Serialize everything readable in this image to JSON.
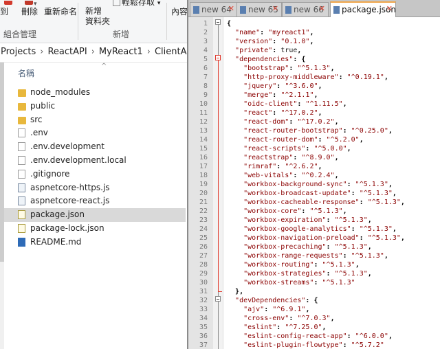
{
  "ribbon": {
    "buttons": [
      "到",
      "刪除",
      "重新命名",
      "新增\n資料夾",
      "輕鬆存取",
      "內容"
    ],
    "groups": [
      "組合管理",
      "新增"
    ]
  },
  "address": {
    "crumbs": [
      "Projects",
      "ReactAPI",
      "MyReact1",
      "ClientApp"
    ]
  },
  "list": {
    "column_name": "名稱",
    "items": [
      {
        "name": "node_modules",
        "icon": "folder-icon"
      },
      {
        "name": "public",
        "icon": "folder-icon"
      },
      {
        "name": "src",
        "icon": "folder-icon"
      },
      {
        "name": ".env",
        "icon": "file-icon"
      },
      {
        "name": ".env.development",
        "icon": "file-icon"
      },
      {
        "name": ".env.development.local",
        "icon": "file-icon"
      },
      {
        "name": ".gitignore",
        "icon": "file-icon"
      },
      {
        "name": "aspnetcore-https.js",
        "icon": "js-file-icon"
      },
      {
        "name": "aspnetcore-react.js",
        "icon": "js-file-icon"
      },
      {
        "name": "package.json",
        "icon": "json-file-icon",
        "selected": true
      },
      {
        "name": "package-lock.json",
        "icon": "json-file-icon"
      },
      {
        "name": "README.md",
        "icon": "markdown-file-icon"
      }
    ]
  },
  "editor": {
    "tabs": [
      {
        "label": "new 64",
        "active": false
      },
      {
        "label": "new 65",
        "active": false
      },
      {
        "label": "new 66",
        "active": false
      },
      {
        "label": "package.json",
        "active": true
      }
    ],
    "lines": [
      "{",
      "  \"name\": \"myreact1\",",
      "  \"version\": \"0.1.0\",",
      "  \"private\": true,",
      "  \"dependencies\": {",
      "    \"bootstrap\": \"^5.1.3\",",
      "    \"http-proxy-middleware\": \"^0.19.1\",",
      "    \"jquery\": \"^3.6.0\",",
      "    \"merge\": \"^2.1.1\",",
      "    \"oidc-client\": \"^1.11.5\",",
      "    \"react\": \"^17.0.2\",",
      "    \"react-dom\": \"^17.0.2\",",
      "    \"react-router-bootstrap\": \"^0.25.0\",",
      "    \"react-router-dom\": \"^5.2.0\",",
      "    \"react-scripts\": \"^5.0.0\",",
      "    \"reactstrap\": \"^8.9.0\",",
      "    \"rimraf\": \"^2.6.2\",",
      "    \"web-vitals\": \"^0.2.4\",",
      "    \"workbox-background-sync\": \"^5.1.3\",",
      "    \"workbox-broadcast-update\": \"^5.1.3\",",
      "    \"workbox-cacheable-response\": \"^5.1.3\",",
      "    \"workbox-core\": \"^5.1.3\",",
      "    \"workbox-expiration\": \"^5.1.3\",",
      "    \"workbox-google-analytics\": \"^5.1.3\",",
      "    \"workbox-navigation-preload\": \"^5.1.3\",",
      "    \"workbox-precaching\": \"^5.1.3\",",
      "    \"workbox-range-requests\": \"^5.1.3\",",
      "    \"workbox-routing\": \"^5.1.3\",",
      "    \"workbox-strategies\": \"^5.1.3\",",
      "    \"workbox-streams\": \"^5.1.3\"",
      "  },",
      "  \"devDependencies\": {",
      "    \"ajv\": \"^6.9.1\",",
      "    \"cross-env\": \"^7.0.3\",",
      "    \"eslint\": \"^7.25.0\",",
      "    \"eslint-config-react-app\": \"^6.0.0\",",
      "    \"eslint-plugin-flowtype\": \"^5.7.2\""
    ]
  },
  "colors": {
    "string": "#8b0000",
    "keyword": "#000080",
    "fold_active": "#e0382b",
    "tab_accent": "#f0a64a",
    "selection": "#d9d9d9"
  }
}
